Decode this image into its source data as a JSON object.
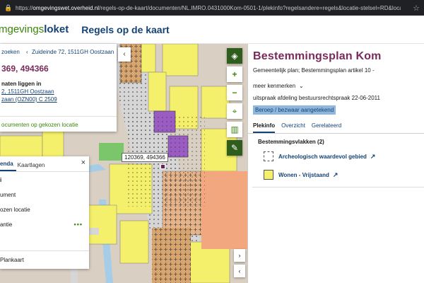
{
  "browser": {
    "url_host": "omgevingswet.overheid.nl",
    "url_path": "/regels-op-de-kaart/documenten/NL.IMRO.0431000Kom-0501-1/plekinfo?regelsandere=regels&locatie-stelsel=RD&locatie-x=120369&locati..."
  },
  "header": {
    "brand_a": "mgevings",
    "brand_b": "loket",
    "title": "Regels op de kaart"
  },
  "search_card": {
    "back_label": "zoeken",
    "address": "Zuideinde 72, 1511GH Oostzaan",
    "coords": "369, 494366",
    "info_text": "naten liggen in",
    "info_link1": "2, 1511GH Oostzaan",
    "info_link2": "zaan (OZN00) C 2509",
    "docs_label": "ocumenten op gekozen locatie"
  },
  "legend": {
    "tab_active": "enda",
    "tab_other": "Kaartlagen",
    "items": [
      "ument",
      "ozen locatie",
      "antie"
    ],
    "first_item": "",
    "plankaart": "Plankaart"
  },
  "map": {
    "tooltip": "120369, 494366",
    "colors": {
      "wonen": "#f5f06b",
      "bedrijf": "#d9a56e",
      "groen": "#7bc66a",
      "water": "#a6cde8",
      "road": "#d7d7d7",
      "centrum": "#f2a77f",
      "marker": "#6b1e5b"
    }
  },
  "panel": {
    "title": "Bestemmingsplan Kom",
    "subtitle": "Gemeentelijk plan; Bestemmingsplan artikel 10 -",
    "meer": "meer kenmerken",
    "uitspraak": "uitspraak afdeling bestuursrechtspraak 22-06-2011",
    "badge": "Beroep / bezwaar aangetekend",
    "tabs": [
      "Plekinfo",
      "Overzicht",
      "Gerelateerd"
    ],
    "section": "Bestemmingsvlakken (2)",
    "vlakken": [
      {
        "label": "Archeologisch waardevol gebied",
        "color": "#ffffff"
      },
      {
        "label": "Wonen - Vrijstaand",
        "color": "#f5f06b"
      }
    ]
  }
}
